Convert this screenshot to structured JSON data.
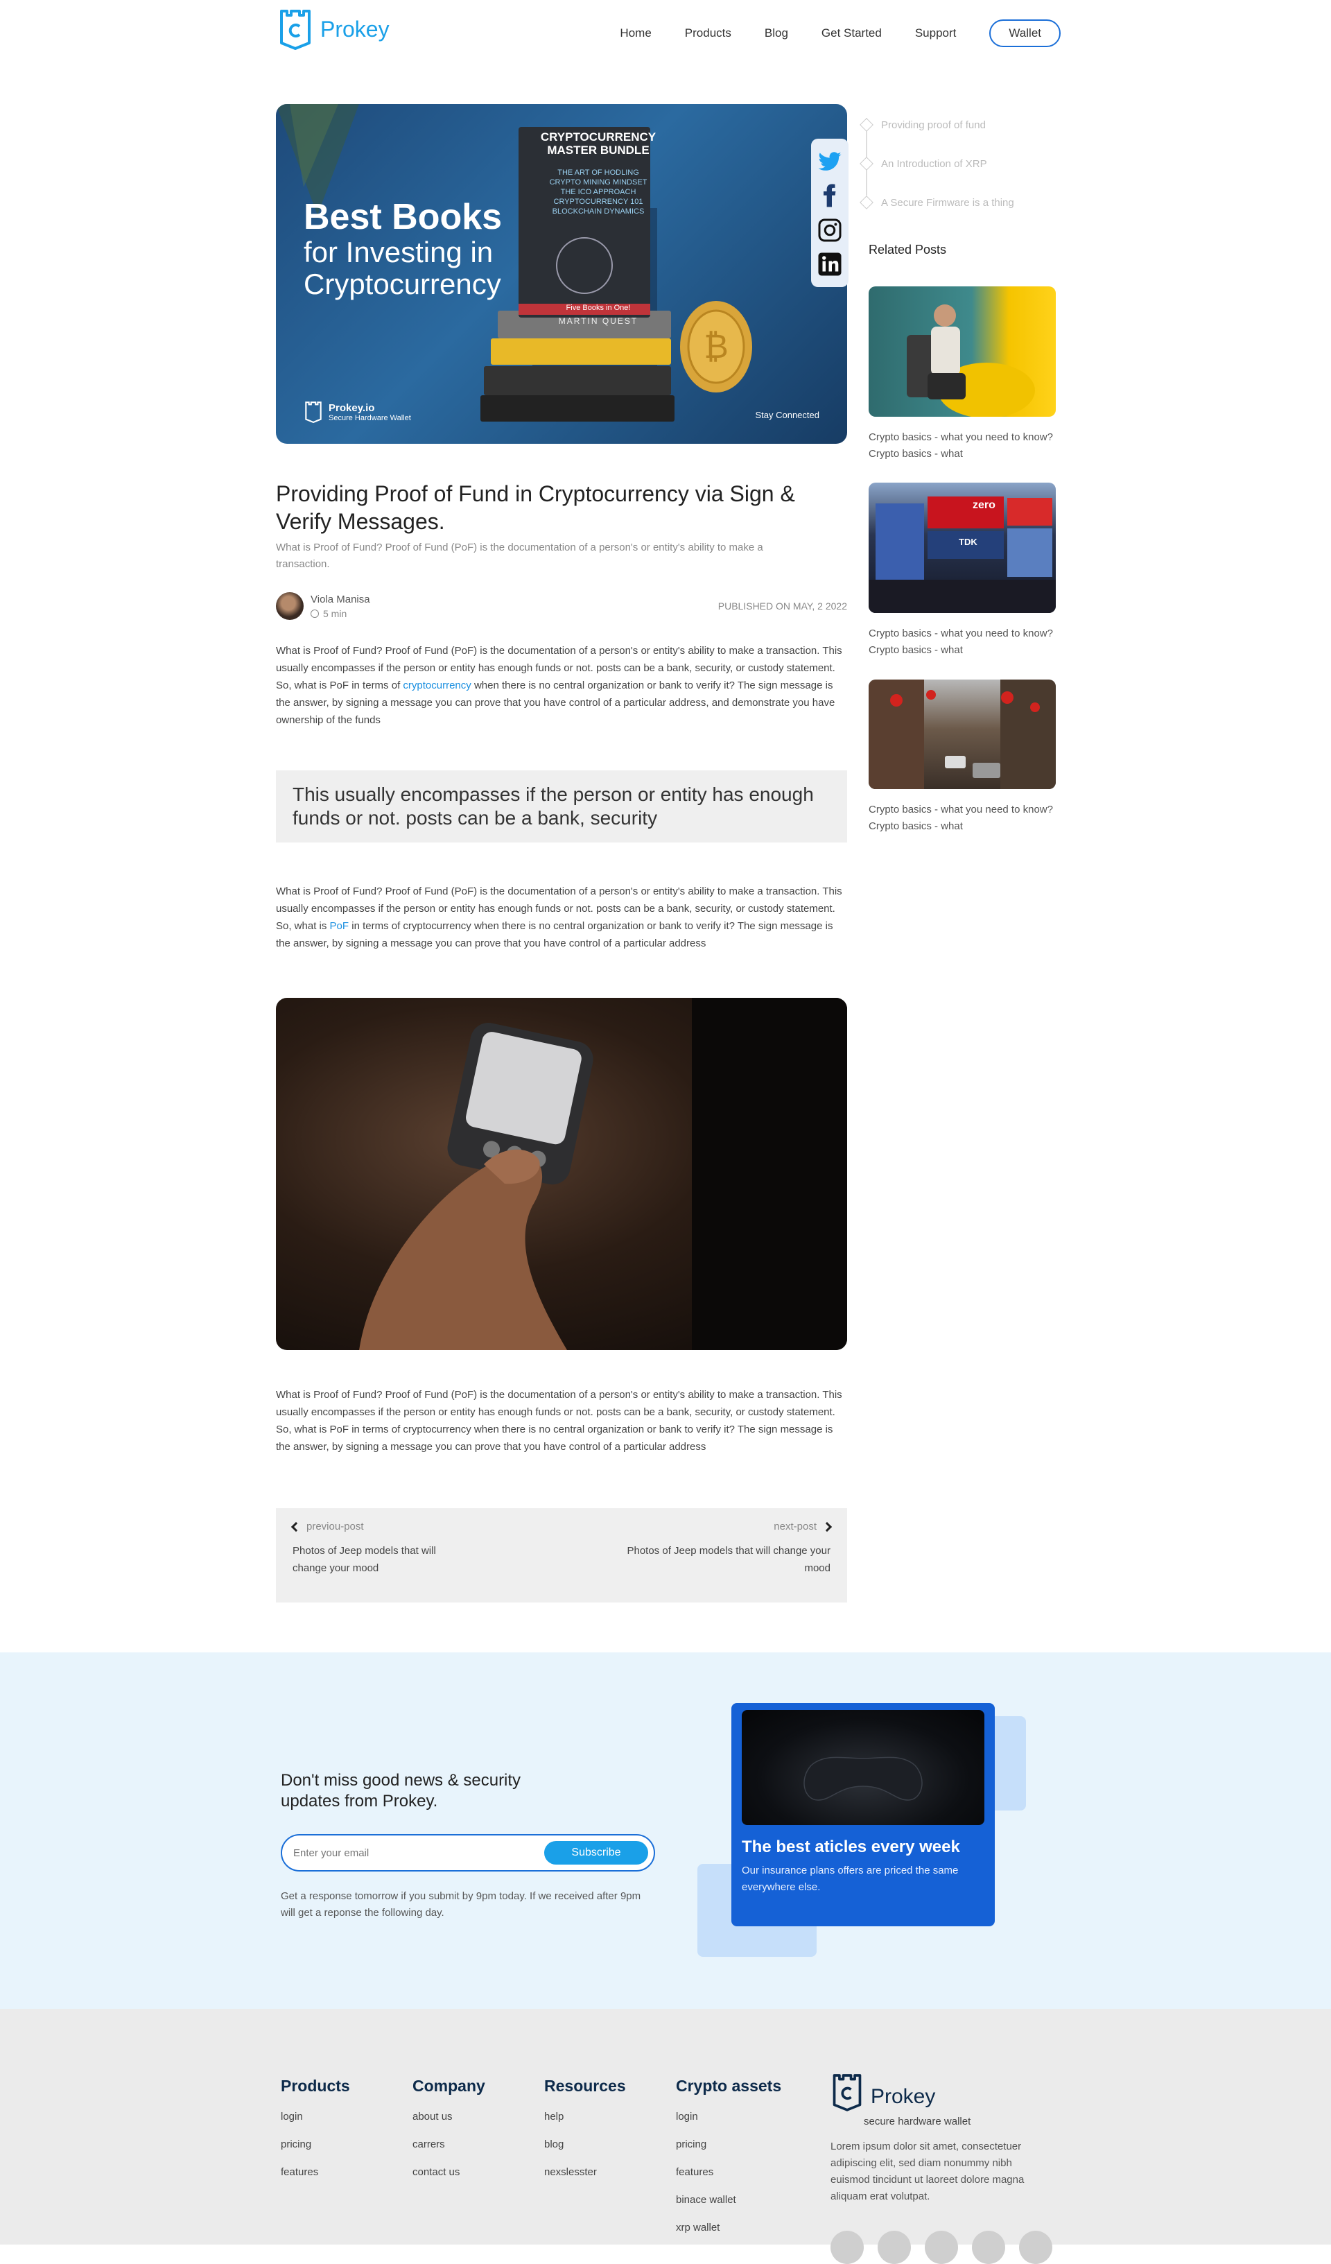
{
  "brand": {
    "name": "Prokey",
    "color": "#1aa0e8"
  },
  "nav": {
    "items": [
      "Home",
      "Products",
      "Blog",
      "Get Started",
      "Support"
    ],
    "wallet": "Wallet"
  },
  "hero": {
    "title_big": "Best Books",
    "title_line2": "for Investing in",
    "title_line3": "Cryptocurrency",
    "book_title": "CRYPTOCURRENCY MASTER BUNDLE",
    "book_lines": [
      "THE ART OF HODLING",
      "CRYPTO MINING MINDSET",
      "THE ICO APPROACH",
      "CRYPTOCURRENCY 101",
      "BLOCKCHAIN DYNAMICS"
    ],
    "book_tag": "Five Books in One!",
    "book_author": "MARTIN QUEST",
    "brand_label": "Prokey.io",
    "brand_sub": "Secure Hardware Wallet",
    "stay": "Stay Connected"
  },
  "post": {
    "title": "Providing Proof of Fund in Cryptocurrency via Sign & Verify Messages.",
    "subtitle": "What is Proof of Fund? Proof of Fund (PoF) is the documentation of a person's or entity's ability to make a transaction.",
    "author": "Viola Manisa",
    "read_time": "5 min",
    "published": "PUBLISHED ON MAY, 2 2022",
    "p1_a": "What is Proof of Fund? Proof of Fund (PoF) is the documentation of a person's or entity's ability to make a transaction. This usually encompasses if the person or entity has enough funds or not. posts can be a bank, security, or custody statement. So, what is PoF in terms of ",
    "p1_link": "cryptocurrency",
    "p1_b": " when there is no central organization or bank to verify it? The sign message is the answer, by signing a message you can prove that you have control of a particular address, and demonstrate you have ownership of the funds",
    "quote": "This usually encompasses if the person or entity has enough funds or not. posts can be a bank, security",
    "p2_a": "What is Proof of Fund? Proof of Fund (PoF) is the documentation of a person's or entity's ability to make a transaction. This usually encompasses if the person or entity has enough funds or not. posts can be a bank, security, or custody statement. So, what is ",
    "p2_link": "PoF",
    "p2_b": " in terms of cryptocurrency when there is no central organization or bank to verify it? The sign message is the answer, by signing a message you can prove that you have control of a particular address",
    "p3": "What is Proof of Fund? Proof of Fund (PoF) is the documentation of a person's or entity's ability to make a transaction. This usually encompasses if the person or entity has enough funds or not. posts can be a bank, security, or custody statement. So, what is PoF in terms of cryptocurrency when there is no central organization or bank to verify it? The sign message is the answer, by signing a message you can prove that you have control of a particular address"
  },
  "postnav": {
    "prev_label": "previou-post",
    "prev_title": "Photos of Jeep models that will change your mood",
    "next_label": "next-post",
    "next_title": "Photos of Jeep models that will change your mood"
  },
  "toc": [
    "Providing proof of fund",
    "An Introduction of XRP",
    "A Secure Firmware is a thing"
  ],
  "related": {
    "title": "Related Posts",
    "items": [
      {
        "caption": "Crypto basics - what you need to know? Crypto basics - what"
      },
      {
        "caption": "Crypto basics - what you need to know? Crypto basics - what",
        "sign_text": "zero",
        "sign_text2": "TDK"
      },
      {
        "caption": "Crypto basics - what you need to know? Crypto basics - what"
      }
    ]
  },
  "newsletter": {
    "title": "Don't miss good news & security updates from Prokey.",
    "placeholder": "Enter your email",
    "button": "Subscribe",
    "note": "Get a response tomorrow if you submit by 9pm today. If we received after 9pm will get a reponse the following day.",
    "card_title": "The best aticles every week",
    "card_text": "Our insurance plans offers are priced the same everywhere else."
  },
  "footer": {
    "columns": [
      {
        "title": "Products",
        "links": [
          "login",
          "pricing",
          "features"
        ]
      },
      {
        "title": "Company",
        "links": [
          "about us",
          "carrers",
          "contact us"
        ]
      },
      {
        "title": "Resources",
        "links": [
          "help",
          "blog",
          "nexslesster"
        ]
      },
      {
        "title": "Crypto assets",
        "links": [
          "login",
          "pricing",
          "features",
          "binace wallet",
          "xrp wallet"
        ]
      }
    ],
    "brand": "Prokey",
    "tagline": "secure hardware wallet",
    "desc": "Lorem ipsum dolor sit amet, consectetuer adipiscing elit, sed diam nonummy nibh euismod tincidunt ut laoreet dolore magna aliquam erat volutpat."
  }
}
